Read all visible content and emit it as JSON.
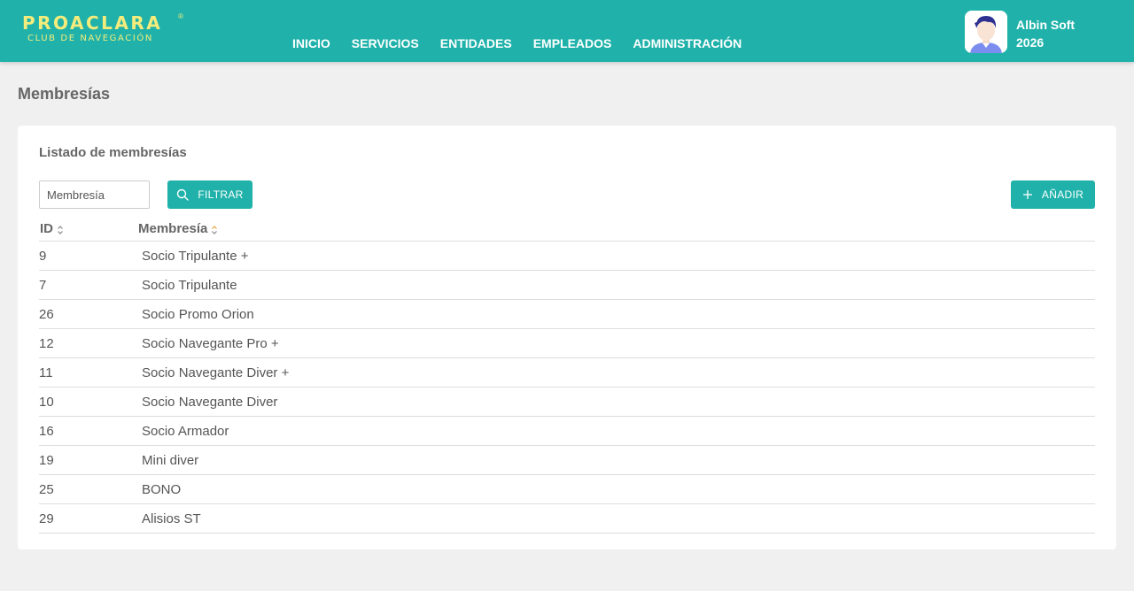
{
  "brand": {
    "name": "PROACLARA",
    "registered": "®",
    "tagline": "CLUB DE NAVEGACIÓN"
  },
  "nav": {
    "items": [
      {
        "label": "INICIO"
      },
      {
        "label": "SERVICIOS"
      },
      {
        "label": "ENTIDADES"
      },
      {
        "label": "EMPLEADOS"
      },
      {
        "label": "ADMINISTRACIÓN"
      }
    ]
  },
  "user": {
    "name": "Albin Soft",
    "year": "2026"
  },
  "page": {
    "title": "Membresías"
  },
  "card": {
    "title": "Listado de membresías",
    "filter_placeholder": "Membresía",
    "filter_button": "FILTRAR",
    "add_button": "AÑADIR"
  },
  "table": {
    "columns": [
      "ID",
      "Membresía"
    ],
    "rows": [
      {
        "id": "9",
        "name": "Socio Tripulante +"
      },
      {
        "id": "7",
        "name": "Socio Tripulante"
      },
      {
        "id": "26",
        "name": "Socio Promo Orion"
      },
      {
        "id": "12",
        "name": "Socio Navegante Pro +"
      },
      {
        "id": "11",
        "name": "Socio Navegante Diver +"
      },
      {
        "id": "10",
        "name": "Socio Navegante Diver"
      },
      {
        "id": "16",
        "name": "Socio Armador"
      },
      {
        "id": "19",
        "name": "Mini diver"
      },
      {
        "id": "25",
        "name": "BONO"
      },
      {
        "id": "29",
        "name": "Alisios ST"
      }
    ]
  },
  "colors": {
    "primary": "#20b2aa",
    "logo": "#f3ec7c",
    "background": "#f0f0f0",
    "sort_active": "#e8a33a"
  },
  "icons": {
    "filter": "search-icon",
    "add": "plus-icon",
    "sort": "sort-icon",
    "avatar": "user-avatar-icon"
  }
}
